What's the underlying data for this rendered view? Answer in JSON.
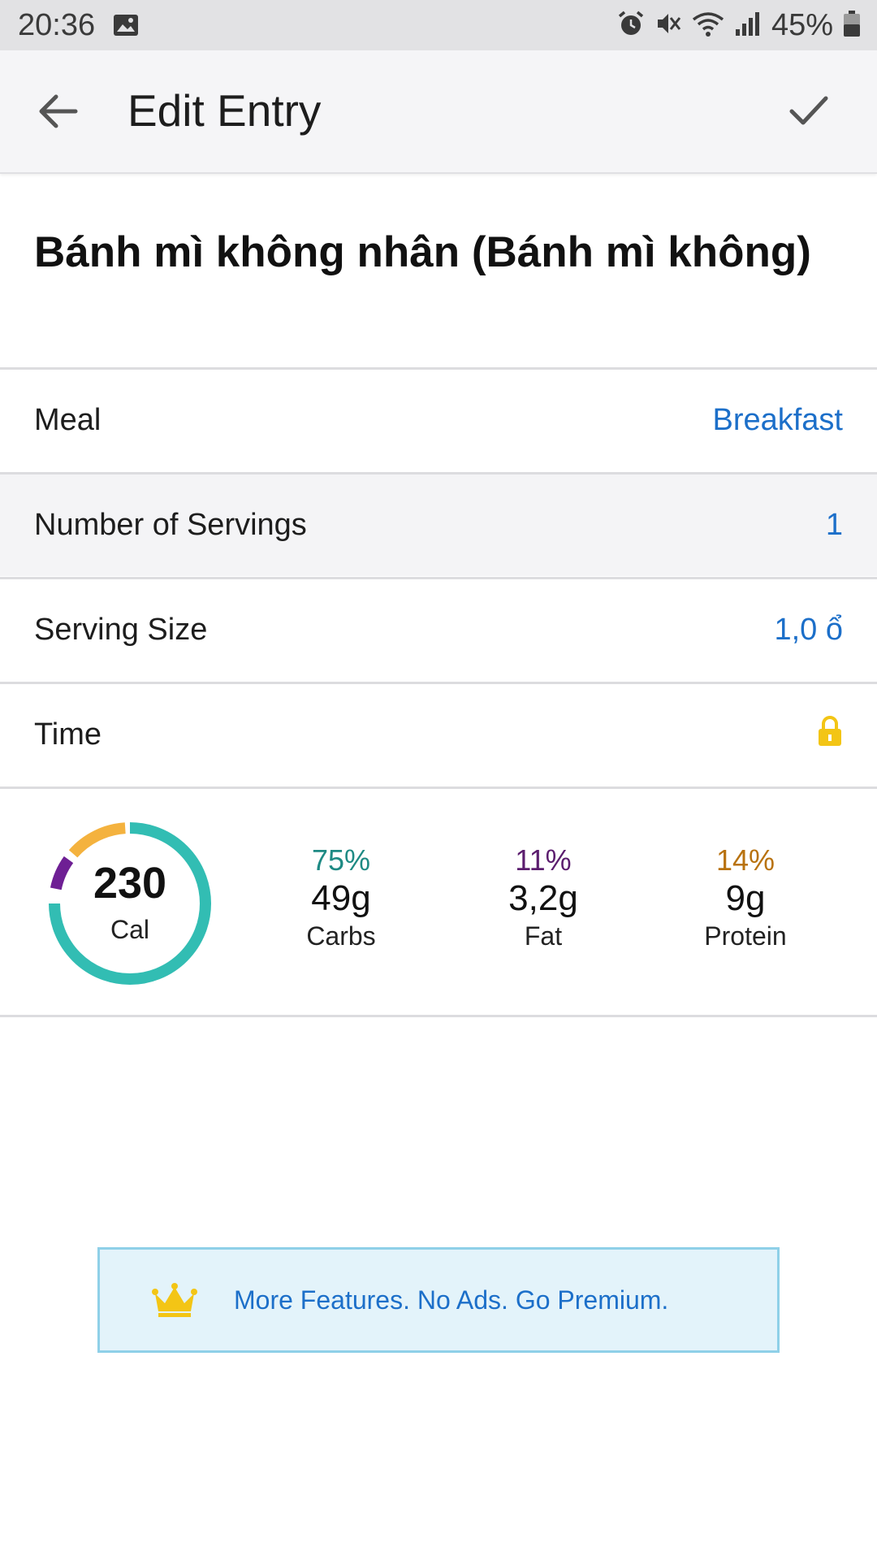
{
  "status_bar": {
    "time": "20:36",
    "battery": "45%",
    "icons": [
      "gallery-icon",
      "alarm-icon",
      "mute-icon",
      "wifi-icon",
      "signal-icon",
      "battery-icon"
    ]
  },
  "app_bar": {
    "title": "Edit Entry",
    "back_icon": "arrow-left-icon",
    "confirm_icon": "check-icon"
  },
  "food": {
    "name": "Bánh mì không nhân (Bánh mì không)"
  },
  "rows": {
    "meal": {
      "label": "Meal",
      "value": "Breakfast"
    },
    "servings": {
      "label": "Number of Servings",
      "value": "1"
    },
    "serving_size": {
      "label": "Serving Size",
      "value": "1,0 ổ"
    },
    "time": {
      "label": "Time",
      "icon": "lock-icon"
    }
  },
  "nutrition": {
    "calories": "230",
    "calories_unit": "Cal",
    "carbs": {
      "percent": "75%",
      "amount": "49g",
      "label": "Carbs",
      "color": "#1e8a84"
    },
    "fat": {
      "percent": "11%",
      "amount": "3,2g",
      "label": "Fat",
      "color": "#5b1d6e"
    },
    "protein": {
      "percent": "14%",
      "amount": "9g",
      "label": "Protein",
      "color": "#b8720f"
    },
    "ring_colors": {
      "carbs": "#32bdb3",
      "fat": "#6e1f94",
      "protein": "#f4b23e"
    }
  },
  "premium": {
    "text": "More Features. No Ads. Go Premium.",
    "icon": "crown-icon"
  }
}
